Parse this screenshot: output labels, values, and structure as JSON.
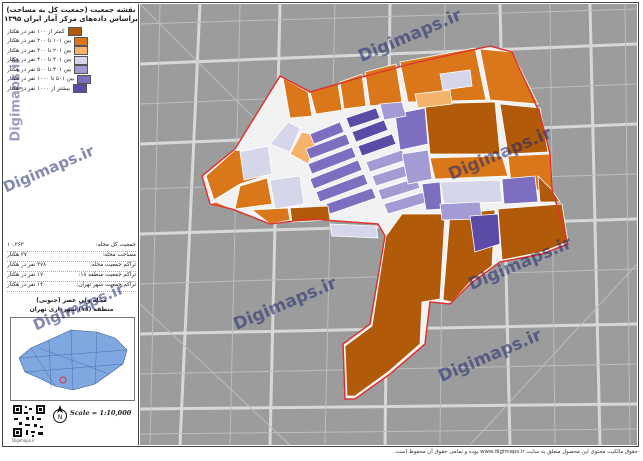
{
  "header": {
    "title": "نقشه جمعیت (جمعیت کل به مساحت)",
    "subtitle": "براساس داده‌های مرکز آمار ایران ۱۳۹۵"
  },
  "legend": [
    {
      "label": "کمتر از ۱۰۰ نفر در هکتار",
      "color": "#b05a0a"
    },
    {
      "label": "بین ۱۰۱ تا ۲۰۰ نفر در هکتار",
      "color": "#d9771a"
    },
    {
      "label": "بین ۲۰۱ تا ۳۰۰ نفر در هکتار",
      "color": "#f5b26a"
    },
    {
      "label": "بین ۳۰۱ تا ۴۰۰ نفر در هکتار",
      "color": "#d6d6ea"
    },
    {
      "label": "بین ۴۰۱ تا ۵۰۰ نفر در هکتار",
      "color": "#a39bd3"
    },
    {
      "label": "بین ۵۰۱ تا ۱۰۰۰ نفر در هکتار",
      "color": "#7d6ec0"
    },
    {
      "label": "بیشتر از ۱۰۰۰ نفر در هکتار",
      "color": "#5b4aa6"
    }
  ],
  "stats": [
    {
      "label": "جمعیت کل محله:",
      "value": "۱۰,۲۶۳"
    },
    {
      "label": "مساحت محله:",
      "value": "۲۷ هکتار"
    },
    {
      "label": "تراکم جمعیت محله:",
      "value": "۳۷۸ نفر در هکتار"
    },
    {
      "label": "تراکم جمعیت منطقه ۱۸:",
      "value": "۱۷۰ نفر در هکتار"
    },
    {
      "label": "تراکم جمعیت شهر تهران:",
      "value": "۱۴۰ نفر در هکتار"
    }
  ],
  "area": {
    "line1": "محله ولی عصر (جنوبی)",
    "line2": "منطقه (۱۸) شهرداری تهران"
  },
  "footer": {
    "scale": "Scale = 1:10,000",
    "credit": "Digimaps.ir"
  },
  "watermark": "Digimaps.ir",
  "bottom_note": "حقوق مالکیت محتوی این محصول متعلق به سایت www.digimaps.ir بوده و تمامی حقوق آن محفوظ است.",
  "colors": {
    "boundary": "#e03030",
    "background": "#9c9c9c",
    "road": "#f2f2f2"
  }
}
